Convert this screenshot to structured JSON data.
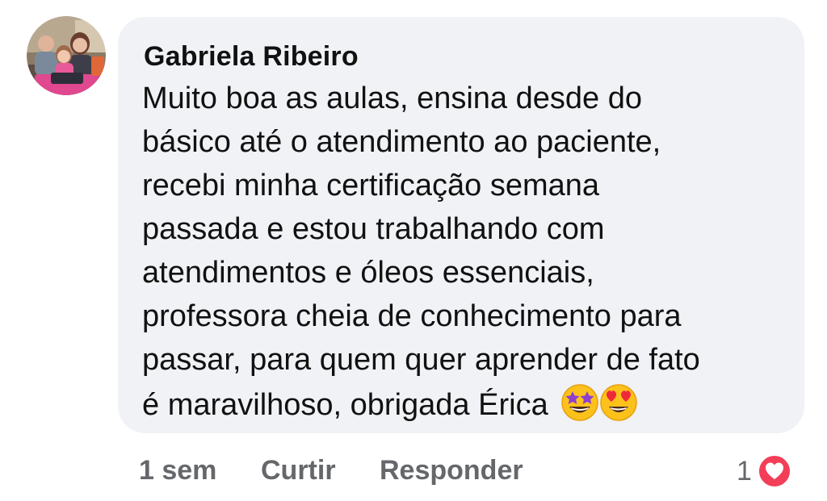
{
  "comment": {
    "author": "Gabriela Ribeiro",
    "lines": [
      "Muito boa as aulas, ensina desde do",
      "básico até o atendimento ao paciente,",
      "recebi minha certificação semana",
      "passada e estou trabalhando com",
      "atendimentos e óleos essenciais,",
      "professora cheia de conhecimento para",
      "passar, para quem quer aprender de fato",
      "é maravilhoso, obrigada Érica"
    ],
    "emojis": [
      "star-struck-emoji",
      "heart-eyes-emoji"
    ],
    "bubble_color": "#f0f2f5"
  },
  "actions": {
    "time": "1 sem",
    "like": "Curtir",
    "reply": "Responder"
  },
  "reactions": {
    "count": "1",
    "icon": "heart-icon",
    "color": "#f33e58"
  }
}
